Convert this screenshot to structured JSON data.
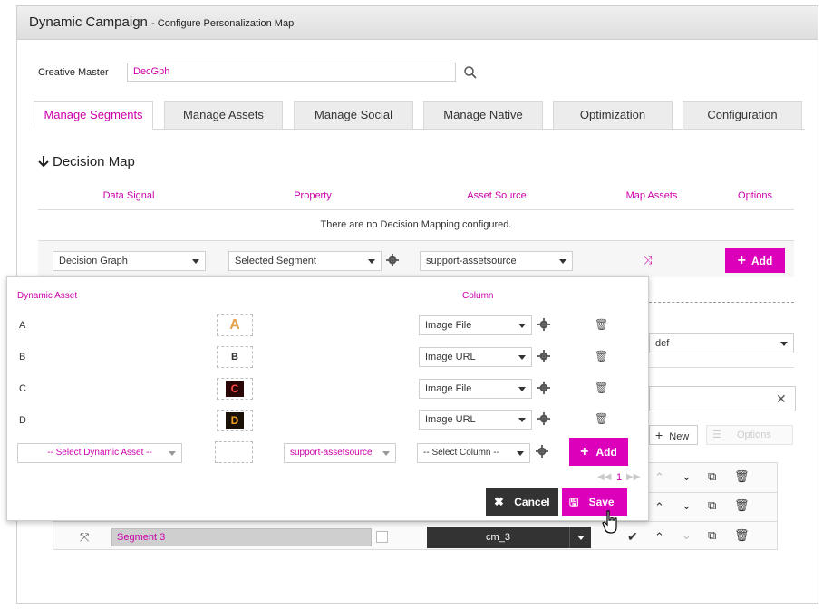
{
  "header": {
    "title": "Dynamic Campaign",
    "subtitle": "- Configure Personalization Map"
  },
  "creative_master": {
    "label": "Creative Master",
    "value": "DecGph"
  },
  "tabs": [
    {
      "label": "Manage Segments"
    },
    {
      "label": "Manage Assets"
    },
    {
      "label": "Manage Social"
    },
    {
      "label": "Manage Native"
    },
    {
      "label": "Optimization"
    },
    {
      "label": "Configuration"
    }
  ],
  "decision_map": {
    "title": "Decision Map",
    "columns": [
      "Data Signal",
      "Property",
      "Asset Source",
      "Map Assets",
      "Options"
    ],
    "empty_message": "There are no Decision Mapping configured.",
    "row": {
      "data_signal": "Decision Graph",
      "property": "Selected Segment",
      "asset_source": "support-assetsource",
      "add_label": "Add"
    }
  },
  "background": {
    "def_select": "def",
    "new_label": "New",
    "options_label": "Options",
    "segment3": {
      "name": "Segment 3",
      "value": "cm_3"
    }
  },
  "popup": {
    "header_dynamic_asset": "Dynamic Asset",
    "header_column": "Column",
    "rows": [
      {
        "label": "A",
        "thumb": "A",
        "column": "Image File"
      },
      {
        "label": "B",
        "thumb": "B",
        "column": "Image URL"
      },
      {
        "label": "C",
        "thumb": "C",
        "column": "Image File"
      },
      {
        "label": "D",
        "thumb": "D",
        "column": "Image URL"
      }
    ],
    "new_row": {
      "asset_placeholder": "-- Select Dynamic Asset --",
      "asset_source": "support-assetsource",
      "column_placeholder": "-- Select Column --",
      "add_label": "Add"
    },
    "pagination": {
      "page": "1"
    },
    "cancel_label": "Cancel",
    "save_label": "Save"
  },
  "colors": {
    "accent": "#dd00bb",
    "accent_text": "#cc00aa",
    "dark_button": "#333333"
  }
}
